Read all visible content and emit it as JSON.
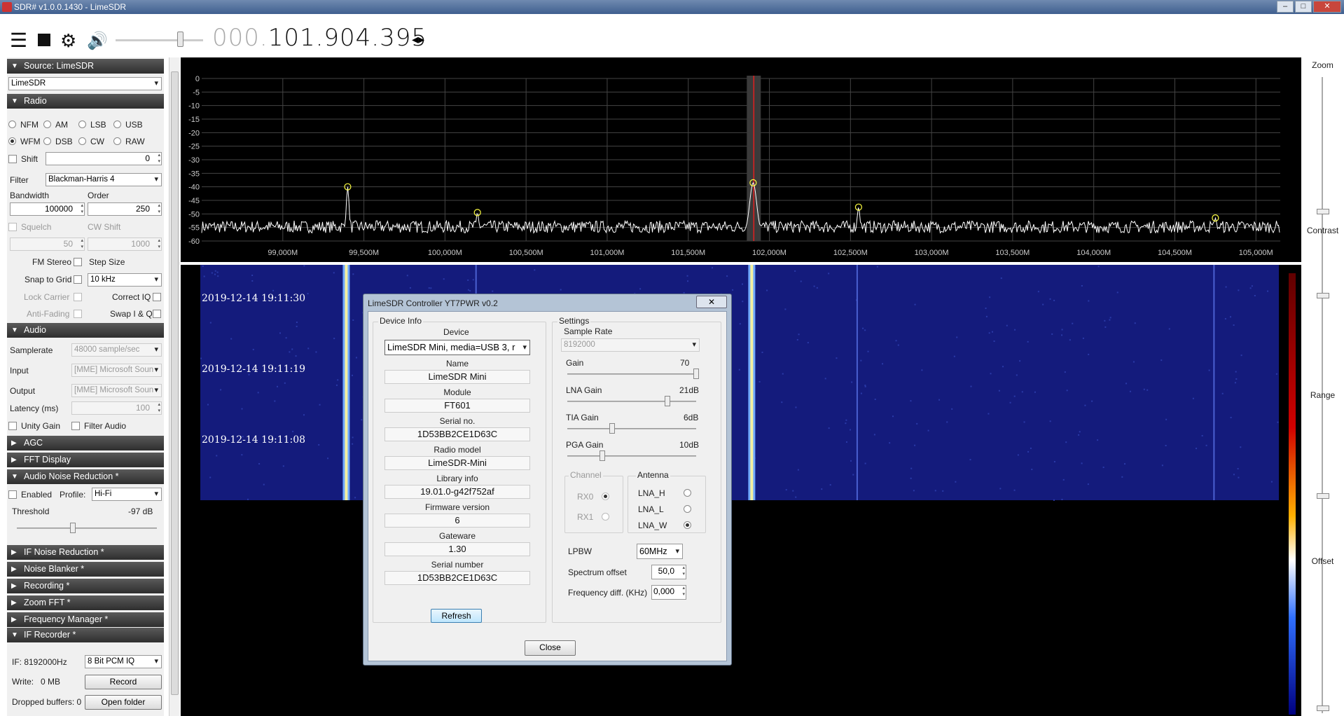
{
  "window": {
    "title": "SDR# v1.0.0.1430 - LimeSDR"
  },
  "toolbar": {
    "freq_dim": "000.",
    "freq_main": "101.904.395"
  },
  "source": {
    "header": "Source: LimeSDR",
    "device": "LimeSDR"
  },
  "radio": {
    "header": "Radio",
    "modes": [
      "NFM",
      "AM",
      "LSB",
      "USB",
      "WFM",
      "DSB",
      "CW",
      "RAW"
    ],
    "selected": "WFM",
    "shift_label": "Shift",
    "shift_value": "0",
    "filter_label": "Filter",
    "filter_value": "Blackman-Harris 4",
    "bandwidth_label": "Bandwidth",
    "bandwidth_value": "100000",
    "order_label": "Order",
    "order_value": "250",
    "squelch_label": "Squelch",
    "squelch_value": "50",
    "cwshift_label": "CW Shift",
    "cwshift_value": "1000",
    "fm_stereo": "FM Stereo",
    "step_size": "Step Size",
    "snap_to_grid": "Snap to Grid",
    "step_value": "10 kHz",
    "lock_carrier": "Lock Carrier",
    "correct_iq": "Correct IQ",
    "anti_fading": "Anti-Fading",
    "swap_iq": "Swap I & Q"
  },
  "audio": {
    "header": "Audio",
    "samplerate_label": "Samplerate",
    "samplerate_value": "48000 sample/sec",
    "input_label": "Input",
    "input_value": "[MME] Microsoft Soun",
    "output_label": "Output",
    "output_value": "[MME] Microsoft Soun",
    "latency_label": "Latency (ms)",
    "latency_value": "100",
    "unity_gain": "Unity Gain",
    "filter_audio": "Filter Audio"
  },
  "collapsed_sections": {
    "agc": "AGC",
    "fft": "FFT Display"
  },
  "anr": {
    "header": "Audio Noise Reduction *",
    "enabled": "Enabled",
    "profile_label": "Profile:",
    "profile_value": "Hi-Fi",
    "threshold_label": "Threshold",
    "threshold_value": "-97 dB"
  },
  "more_sections": [
    "IF Noise Reduction *",
    "Noise Blanker *",
    "Recording *",
    "Zoom FFT *",
    "Frequency Manager *"
  ],
  "ifrec": {
    "header": "IF Recorder *",
    "if_label": "IF: 8192000Hz",
    "format_value": "8 Bit PCM IQ",
    "write_label": "Write:",
    "write_value": "0 MB",
    "record_btn": "Record",
    "dropped_label": "Dropped buffers: 0",
    "open_btn": "Open folder"
  },
  "spectrum": {
    "y_ticks": [
      "0",
      "-5",
      "-10",
      "-15",
      "-20",
      "-25",
      "-30",
      "-35",
      "-40",
      "-45",
      "-50",
      "-55",
      "-60"
    ],
    "x_ticks": [
      "99,000M",
      "99,500M",
      "100,000M",
      "100,500M",
      "101,000M",
      "101,500M",
      "102,000M",
      "102,500M",
      "103,000M",
      "103,500M",
      "104,000M",
      "104,500M",
      "105,000M"
    ],
    "x_range_mhz": [
      98.5,
      105.15
    ],
    "y_range_db": [
      -60,
      0
    ],
    "center_mhz": 101.904,
    "peaks": [
      {
        "freq": 99.4,
        "db": -40
      },
      {
        "freq": 100.2,
        "db": -49.5
      },
      {
        "freq": 101.9,
        "db": -38.5
      },
      {
        "freq": 102.55,
        "db": -47.5
      },
      {
        "freq": 104.75,
        "db": -51.5
      }
    ]
  },
  "waterfall": {
    "timestamps": [
      "2019-12-14 19:11:30",
      "2019-12-14 19:11:19",
      "2019-12-14 19:11:08"
    ]
  },
  "rightpanel": {
    "zoom": "Zoom",
    "contrast": "Contrast",
    "range": "Range",
    "offset": "Offset"
  },
  "dialog": {
    "title": "LimeSDR Controller YT7PWR   v0.2",
    "close_x": "✕",
    "device_info": "Device Info",
    "device_label": "Device",
    "device_value": "LimeSDR Mini, media=USB 3, r",
    "fields": [
      {
        "label": "Name",
        "value": "LimeSDR Mini"
      },
      {
        "label": "Module",
        "value": "FT601"
      },
      {
        "label": "Serial no.",
        "value": "1D53BB2CE1D63C"
      },
      {
        "label": "Radio model",
        "value": "LimeSDR-Mini"
      },
      {
        "label": "Library info",
        "value": "19.01.0-g42f752af"
      },
      {
        "label": "Firmware version",
        "value": "6"
      },
      {
        "label": "Gateware",
        "value": "1.30"
      },
      {
        "label": "Serial number",
        "value": "1D53BB2CE1D63C"
      }
    ],
    "refresh": "Refresh",
    "settings": "Settings",
    "sample_rate_label": "Sample Rate",
    "sample_rate_value": "8192000",
    "gain_label": "Gain",
    "gain_value": "70",
    "lna_label": "LNA Gain",
    "lna_value": "21dB",
    "tia_label": "TIA Gain",
    "tia_value": "6dB",
    "pga_label": "PGA Gain",
    "pga_value": "10dB",
    "channel": "Channel",
    "rx0": "RX0",
    "rx1": "RX1",
    "antenna": "Antenna",
    "lna_h": "LNA_H",
    "lna_l": "LNA_L",
    "lna_w": "LNA_W",
    "lpbw_label": "LPBW",
    "lpbw_value": "60MHz",
    "spec_offset_label": "Spectrum offset",
    "spec_offset_value": "50,0",
    "freq_diff_label": "Frequency diff. (KHz)",
    "freq_diff_value": "0,000",
    "close_btn": "Close"
  }
}
